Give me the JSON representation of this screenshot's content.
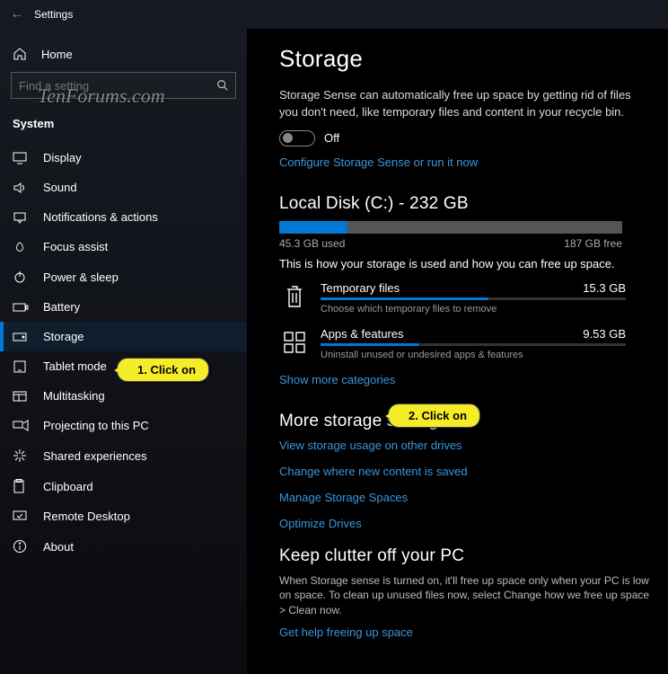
{
  "window": {
    "title": "Settings"
  },
  "watermark": "TenForums.com",
  "sidebar": {
    "home": "Home",
    "search_placeholder": "Find a setting",
    "section": "System",
    "items": [
      {
        "icon": "display-icon",
        "label": "Display"
      },
      {
        "icon": "sound-icon",
        "label": "Sound"
      },
      {
        "icon": "notif-icon",
        "label": "Notifications & actions"
      },
      {
        "icon": "focus-icon",
        "label": "Focus assist"
      },
      {
        "icon": "power-icon",
        "label": "Power & sleep"
      },
      {
        "icon": "battery-icon",
        "label": "Battery"
      },
      {
        "icon": "storage-icon",
        "label": "Storage",
        "selected": true
      },
      {
        "icon": "tablet-icon",
        "label": "Tablet mode"
      },
      {
        "icon": "multitask-icon",
        "label": "Multitasking"
      },
      {
        "icon": "project-icon",
        "label": "Projecting to this PC"
      },
      {
        "icon": "shared-icon",
        "label": "Shared experiences"
      },
      {
        "icon": "clipboard-icon",
        "label": "Clipboard"
      },
      {
        "icon": "remote-icon",
        "label": "Remote Desktop"
      },
      {
        "icon": "about-icon",
        "label": "About"
      }
    ]
  },
  "main": {
    "title": "Storage",
    "sense_desc": "Storage Sense can automatically free up space by getting rid of files you don't need, like temporary files and content in your recycle bin.",
    "toggle_state": "Off",
    "configure_link": "Configure Storage Sense or run it now",
    "disk": {
      "heading": "Local Disk (C:) - 232 GB",
      "used_pct": 20,
      "used_label": "45.3 GB used",
      "free_label": "187 GB free",
      "explain": "This is how your storage is used and how you can free up space."
    },
    "categories": [
      {
        "name": "Temporary files",
        "size": "15.3 GB",
        "pct": 55,
        "sub": "Choose which temporary files to remove",
        "icon": "trash-icon"
      },
      {
        "name": "Apps & features",
        "size": "9.53 GB",
        "pct": 32,
        "sub": "Uninstall unused or undesired apps & features",
        "icon": "apps-icon"
      }
    ],
    "show_more": "Show more categories",
    "more_heading": "More storage settings",
    "more_links": [
      "View storage usage on other drives",
      "Change where new content is saved",
      "Manage Storage Spaces",
      "Optimize Drives"
    ],
    "clutter_heading": "Keep clutter off your PC",
    "clutter_body": "When Storage sense is turned on, it'll free up space only when your PC is low on space. To clean up unused files now, select Change how we free up space > Clean now.",
    "clutter_link": "Get help freeing up space"
  },
  "annotations": {
    "callout1": "1. Click on",
    "callout2": "2. Click on"
  }
}
